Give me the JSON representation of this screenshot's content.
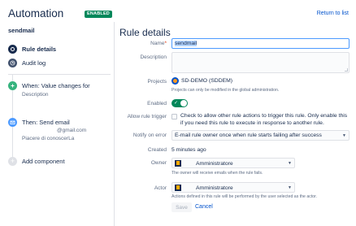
{
  "header": {
    "title": "Automation",
    "badge": "ENABLED",
    "return_link": "Return to list"
  },
  "sidebar": {
    "rule_name": "sendmail",
    "items": [
      {
        "label": "Rule details",
        "icon": "info-icon",
        "active": true
      },
      {
        "label": "Audit log",
        "icon": "clock-icon",
        "active": false
      }
    ],
    "trigger": {
      "title": "When: Value changes for",
      "subtitle": "Description",
      "icon": "trigger-icon",
      "color": "#36b37e"
    },
    "action": {
      "title": "Then: Send email",
      "line1": "@gmail.com",
      "line2": "Piacere di conoscerLa",
      "icon": "email-icon",
      "color": "#4c9aff"
    },
    "add_component": "Add component"
  },
  "details": {
    "title": "Rule details",
    "name_label": "Name",
    "name_value": "sendmail",
    "description_label": "Description",
    "projects_label": "Projects",
    "project_value": "SD-DEMO (SDDEM)",
    "project_help": "Projects can only be modified in the global administration.",
    "enabled_label": "Enabled",
    "enabled": true,
    "allow_trigger_label": "Allow rule trigger",
    "allow_trigger_text": "Check to allow other rule actions to trigger this rule. Only enable this if you need this rule to execute in response to another rule.",
    "notify_label": "Notify on error",
    "notify_value": "E-mail rule owner once when rule starts failing after success",
    "created_label": "Created",
    "created_value": "5 minutes ago",
    "owner_label": "Owner",
    "owner_value": "Amministratore",
    "owner_help": "The owner will receive emails when the rule fails.",
    "actor_label": "Actor",
    "actor_value": "Amministratore",
    "actor_help": "Actions defined in this rule will be performed by the user selected as the actor.",
    "save_label": "Save",
    "cancel_label": "Cancel"
  },
  "colors": {
    "accent": "#0052cc",
    "enabled": "#00875a",
    "required": "#de350b"
  }
}
